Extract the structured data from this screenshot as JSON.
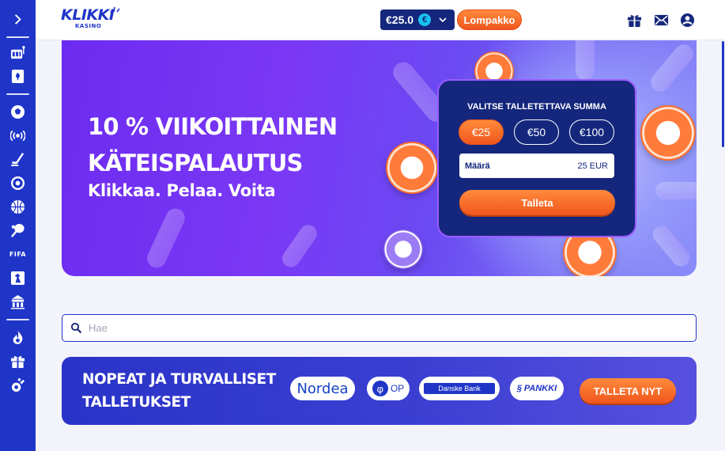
{
  "sidebar": {
    "expand_icon": "chevron-right-icon",
    "items": [
      {
        "name": "sidebar-item-slots",
        "icon": "slot-machine-icon"
      },
      {
        "name": "sidebar-item-table-games",
        "icon": "playing-card-icon"
      },
      {
        "name": "sidebar-item-sports",
        "icon": "soccer-ball-icon"
      },
      {
        "name": "sidebar-item-live",
        "icon": "live-broadcast-icon"
      },
      {
        "name": "sidebar-item-hockey",
        "icon": "hockey-stick-icon"
      },
      {
        "name": "sidebar-item-football",
        "icon": "football-icon"
      },
      {
        "name": "sidebar-item-basketball",
        "icon": "basketball-icon"
      },
      {
        "name": "sidebar-item-tennis",
        "icon": "tennis-icon"
      },
      {
        "name": "sidebar-item-fifa",
        "label": "FIFA"
      },
      {
        "name": "sidebar-item-esports",
        "icon": "esports-icon"
      },
      {
        "name": "sidebar-item-casino",
        "icon": "casino-building-icon"
      },
      {
        "name": "sidebar-item-hot",
        "icon": "flame-icon"
      },
      {
        "name": "sidebar-item-promotions",
        "icon": "gift-icon"
      },
      {
        "name": "sidebar-item-vip",
        "icon": "trophy-icon"
      }
    ]
  },
  "header": {
    "logo_text": "KLIKKI",
    "logo_sub": "KASINO",
    "balance": "€25.0",
    "currency_symbol": "€",
    "wallet_label": "Lompakko",
    "icons": [
      "gift-icon",
      "mail-icon",
      "user-icon"
    ]
  },
  "hero": {
    "title_line1": "10 % VIIKOITTAINEN",
    "title_line2": "KÄTEISPALAUTUS",
    "subtitle": "Klikkaa. Pelaa. Voita",
    "deposit": {
      "title": "VALITSE TALLETETTAVA SUMMA",
      "amounts": [
        "€25",
        "€50",
        "€100"
      ],
      "selected_amount": "€25",
      "amount_label": "Määrä",
      "amount_value": "25 EUR",
      "button_label": "Talleta"
    }
  },
  "search": {
    "placeholder": "Hae"
  },
  "payments": {
    "title_line1": "NOPEAT JA TURVALLISET",
    "title_line2": "TALLETUKSET",
    "banks": {
      "nordea": "Nordea",
      "op": "OP",
      "danske": "Danske Bank",
      "spankki": "PANKKI"
    },
    "button_label": "TALLETA NYT"
  },
  "colors": {
    "brand_blue": "#1f35c8",
    "navy": "#14277d",
    "orange": "#f0561d",
    "hero_purple": "#6c2bf0"
  }
}
